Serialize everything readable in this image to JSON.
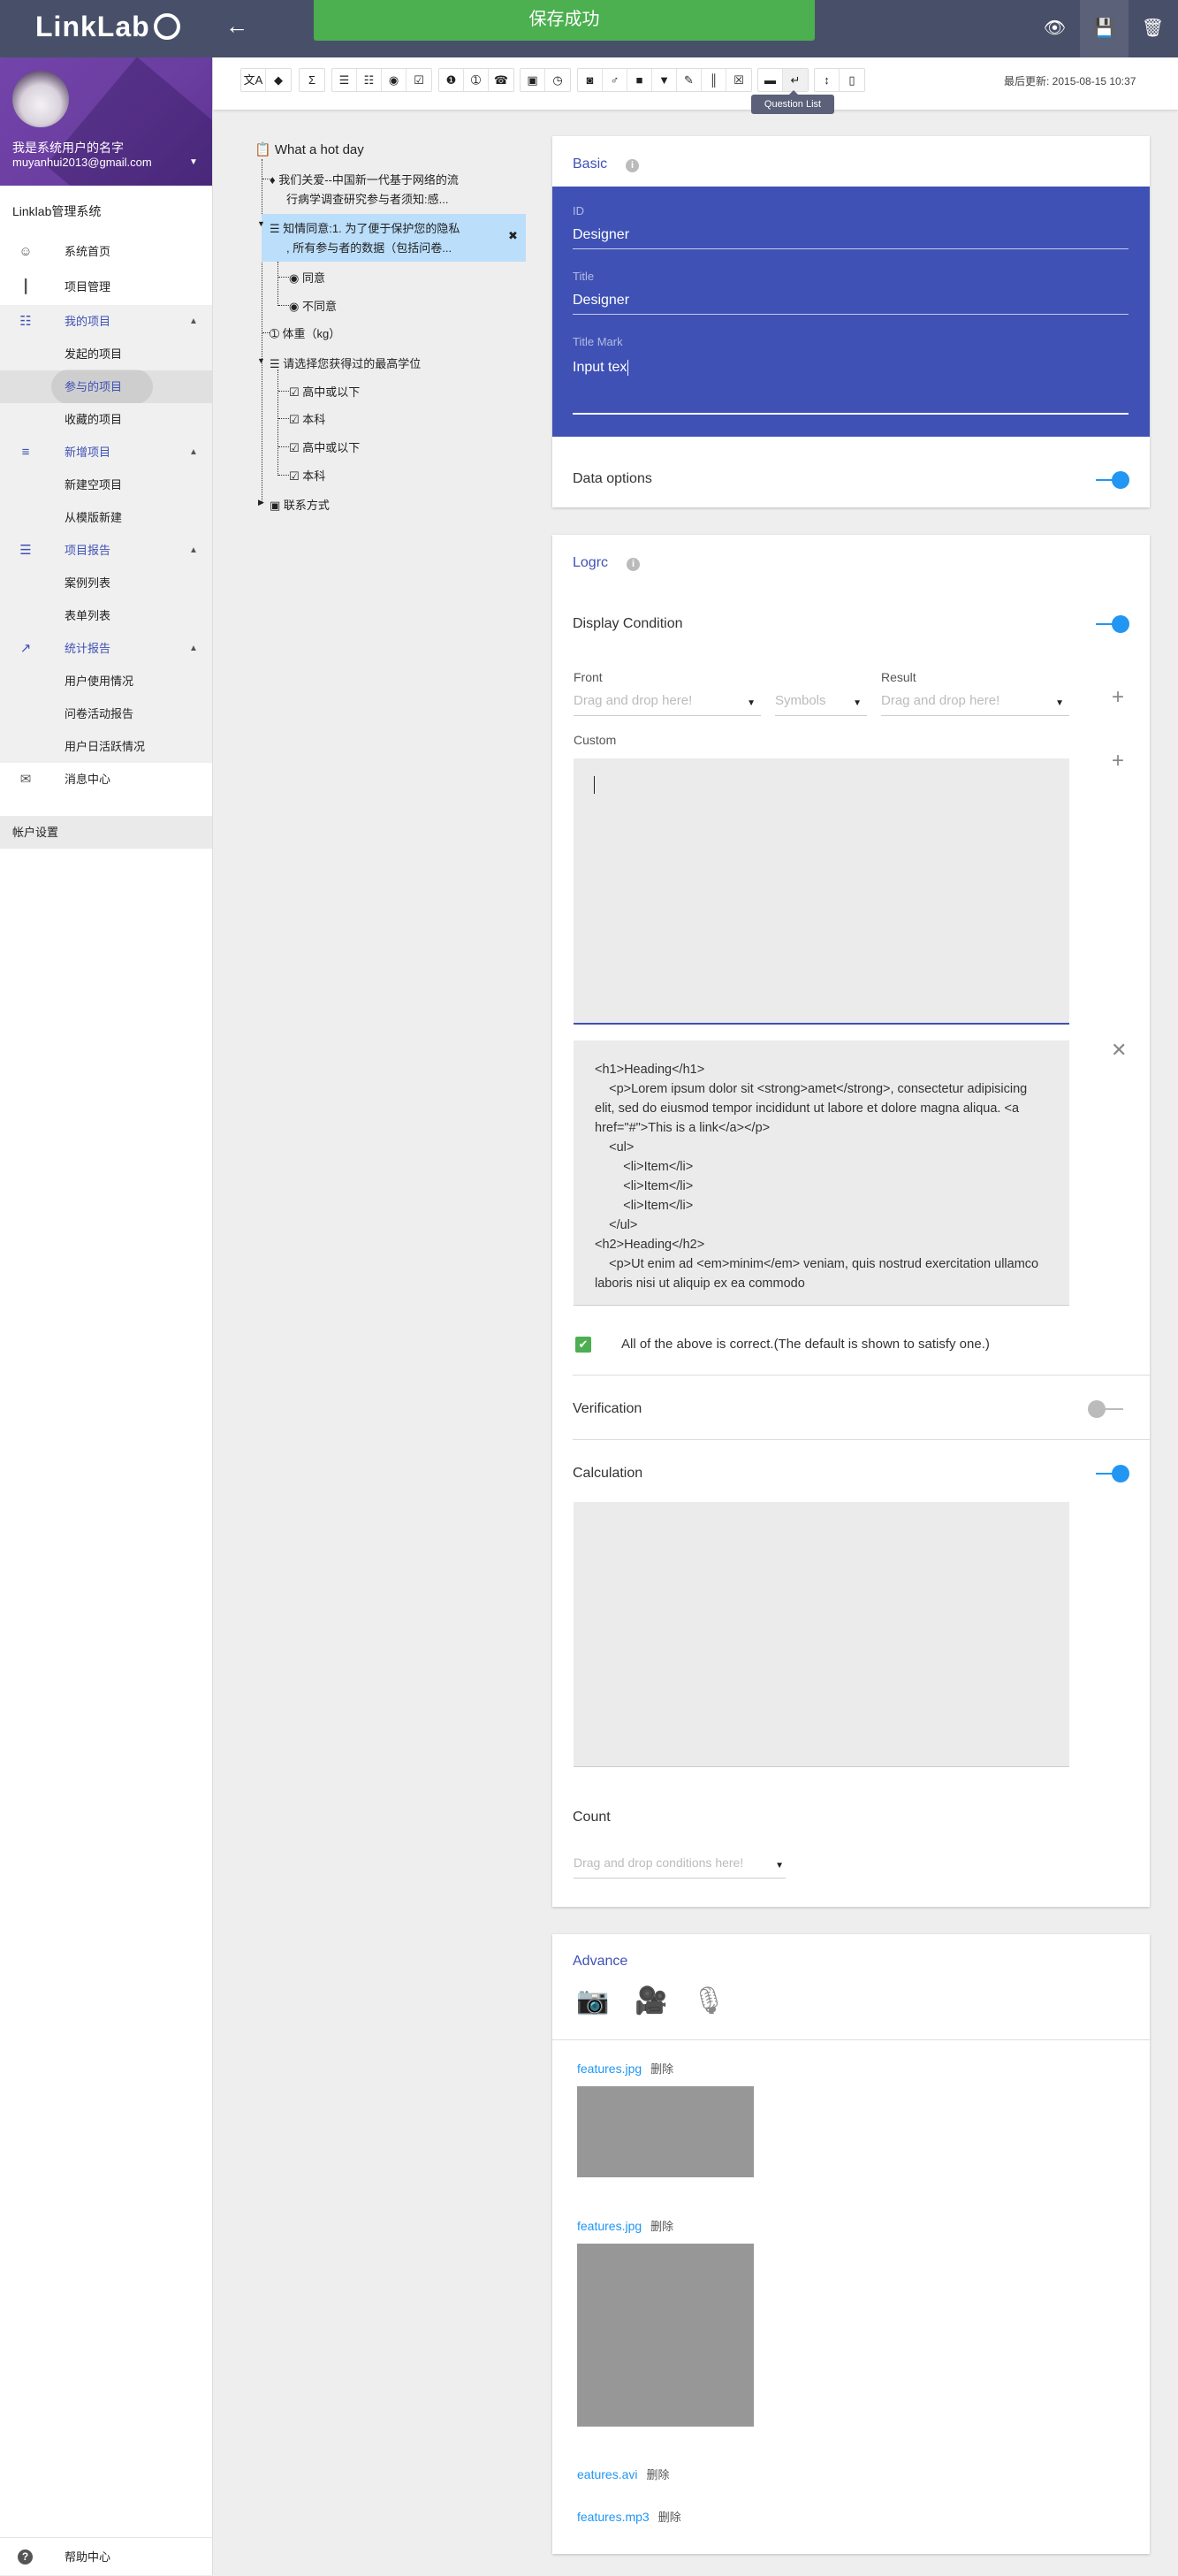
{
  "header": {
    "logo": "LinkLab",
    "banner": "保存成功",
    "icons": [
      "arrow-back-icon",
      "eye-icon",
      "save-icon",
      "delete-icon"
    ]
  },
  "profile": {
    "name": "我是系统用户的名字",
    "email": "muyanhui2013@gmail.com"
  },
  "sidebar": {
    "title": "Linklab管理系统",
    "items": [
      {
        "label": "系统首页",
        "icon": "dashboard-icon",
        "type": "top"
      },
      {
        "label": "项目管理",
        "icon": "waveform-icon",
        "type": "top"
      },
      {
        "label": "我的项目",
        "icon": "apps-grid-icon",
        "type": "section",
        "expanded": true
      },
      {
        "label": "发起的项目",
        "type": "sub"
      },
      {
        "label": "参与的项目",
        "type": "sub",
        "active": true
      },
      {
        "label": "收藏的项目",
        "type": "sub"
      },
      {
        "label": "新增项目",
        "icon": "playlist-add-icon",
        "type": "section",
        "expanded": true
      },
      {
        "label": "新建空项目",
        "type": "sub"
      },
      {
        "label": "从模版新建",
        "type": "sub"
      },
      {
        "label": "项目报告",
        "icon": "list-icon",
        "type": "section",
        "expanded": true
      },
      {
        "label": "案例列表",
        "type": "sub"
      },
      {
        "label": "表单列表",
        "type": "sub"
      },
      {
        "label": "统计报告",
        "icon": "trending-up-icon",
        "type": "section",
        "expanded": true
      },
      {
        "label": "用户使用情况",
        "type": "sub"
      },
      {
        "label": "问卷活动报告",
        "type": "sub"
      },
      {
        "label": "用户日活跃情况",
        "type": "sub"
      },
      {
        "label": "消息中心",
        "icon": "mail-icon",
        "type": "top"
      }
    ],
    "account": "帐户设置",
    "help": "帮助中心"
  },
  "toolbar": {
    "groups": [
      [
        "translate-icon",
        "tag-icon"
      ],
      [
        "sigma-icon"
      ],
      [
        "numbered-list-icon",
        "bulleted-list-icon",
        "radio-icon",
        "checkbox-icon"
      ],
      [
        "number-one-icon",
        "number-box-icon",
        "phone-icon"
      ],
      [
        "calendar-icon",
        "clock-icon"
      ],
      [
        "camera-icon",
        "mic-icon",
        "video-icon",
        "location-icon",
        "pencil-icon",
        "split-icon",
        "lock-icon"
      ],
      [
        "briefcase-icon",
        "wrap-text-icon"
      ],
      [
        "vertical-align-icon",
        "device-icon"
      ]
    ],
    "tooltip": "Question List",
    "updated": "最后更新: 2015-08-15 10:37"
  },
  "tree": {
    "root": "What a hot day",
    "notice": [
      "我们关爱--中国新一代基于网络的流",
      "行病学调查研究参与者须知:感..."
    ],
    "consent": [
      "知情同意:1. 为了便于保护您的隐私",
      ", 所有参与者的数据（包括问卷..."
    ],
    "consent_options": [
      "同意",
      "不同意"
    ],
    "weight": "体重（kg）",
    "degree": "请选择您获得过的最高学位",
    "degree_options": [
      "高中或以下",
      "本科",
      "高中或以下",
      "本科"
    ],
    "contact": "联系方式"
  },
  "basic": {
    "title": "Basic",
    "id_label": "ID",
    "id_value": "Designer",
    "title_label": "Title",
    "title_value": "Designer",
    "mark_label": "Title Mark",
    "mark_value": "Input tex",
    "data_options": "Data options",
    "data_options_on": true
  },
  "logic": {
    "title": "Logrc",
    "display_condition": "Display Condition",
    "display_condition_on": true,
    "front_label": "Front",
    "front_placeholder": "Drag and drop here!",
    "symbols_placeholder": "Symbols",
    "result_label": "Result",
    "result_placeholder": "Drag and drop here!",
    "custom_label": "Custom",
    "code": "<h1>Heading</h1>\n\t<p>Lorem ipsum dolor sit <strong>amet</strong>, consectetur adipisicing elit, sed do eiusmod tempor incididunt ut labore et dolore magna aliqua. <a href=\"#\">This is a link</a></p>\n\t<ul>\n\t\t<li>Item</li>\n\t\t<li>Item</li>\n\t\t<li>Item</li>\n\t</ul>\n<h2>Heading</h2>\n\t<p>Ut enim ad <em>minim</em> veniam, quis nostrud exercitation ullamco laboris nisi ut aliquip ex ea commodo",
    "all_correct": "All of the above is correct.(The default is shown to satisfy one.)",
    "all_correct_checked": true,
    "verification": "Verification",
    "verification_on": false,
    "calculation": "Calculation",
    "calculation_on": true,
    "count": "Count",
    "count_placeholder": "Drag and drop conditions here!"
  },
  "advance": {
    "title": "Advance",
    "media_icons": [
      "camera-icon",
      "videocam-icon",
      "mic-icon"
    ],
    "files": [
      {
        "name": "features.jpg",
        "delete": "删除"
      },
      {
        "name": "features.jpg",
        "delete": "删除"
      },
      {
        "name": "eatures.avi",
        "delete": "删除"
      },
      {
        "name": "features.mp3",
        "delete": "删除"
      }
    ]
  },
  "colors": {
    "header": "#485069",
    "primary": "#3f51b5",
    "success": "#4caf50",
    "toggle": "#2196f3",
    "profile": "#6a3da0"
  }
}
